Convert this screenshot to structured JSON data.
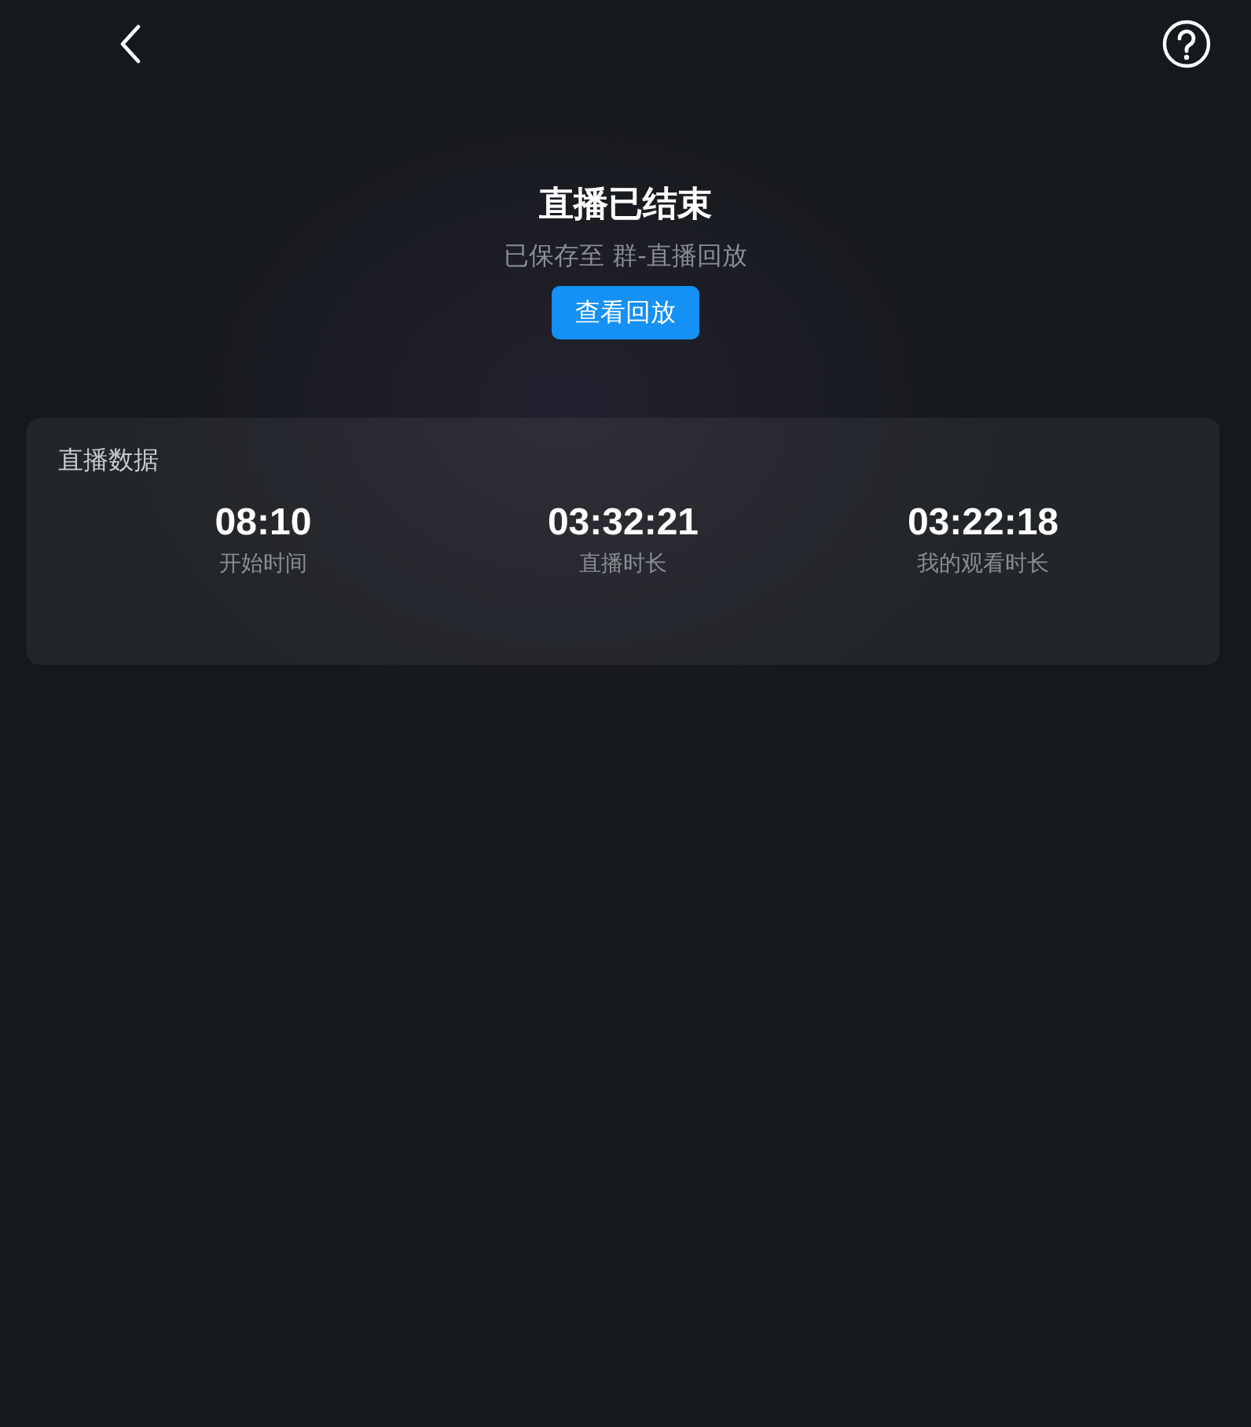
{
  "header": {
    "title": "直播已结束",
    "subtitle": "已保存至 群-直播回放",
    "button": "查看回放"
  },
  "stats_card": {
    "title": "直播数据",
    "items": [
      {
        "value": "08:10",
        "label": "开始时间"
      },
      {
        "value": "03:32:21",
        "label": "直播时长"
      },
      {
        "value": "03:22:18",
        "label": "我的观看时长"
      }
    ]
  }
}
